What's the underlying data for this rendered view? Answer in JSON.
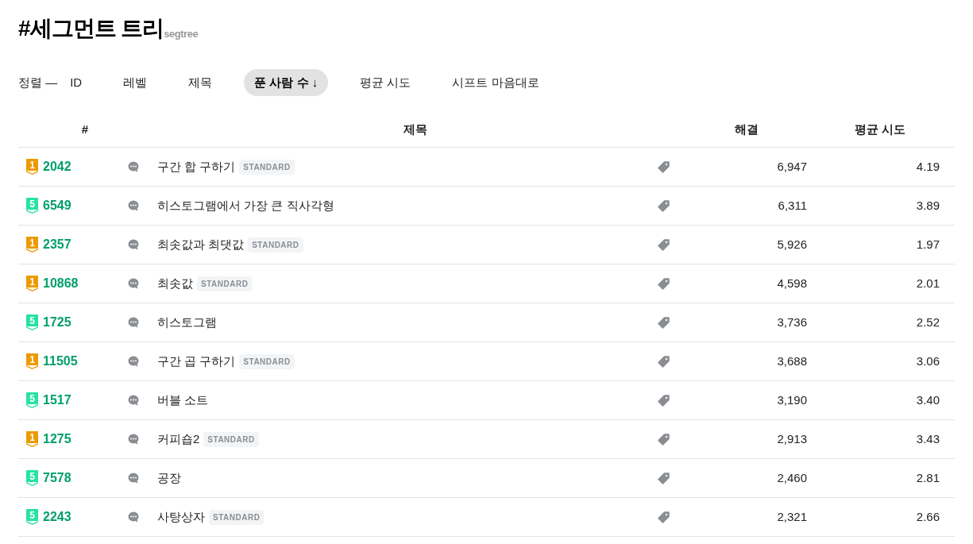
{
  "title": "#세그먼트 트리",
  "subtitle": "segtree",
  "sort": {
    "label": "정렬 —",
    "options": [
      {
        "label": "ID",
        "selected": false
      },
      {
        "label": "레벨",
        "selected": false
      },
      {
        "label": "제목",
        "selected": false
      },
      {
        "label": "푼 사람 수 ↓",
        "selected": true
      },
      {
        "label": "평균 시도",
        "selected": false
      },
      {
        "label": "시프트 마음대로",
        "selected": false
      }
    ]
  },
  "table": {
    "columns": [
      "#",
      "제목",
      "해결",
      "평균 시도"
    ],
    "rows": [
      {
        "color": "#ec9a00",
        "tier_number": "1",
        "id": "2042",
        "title": "구간 합 구하기",
        "tag": "STANDARD",
        "solved": "6,947",
        "average_tries": "4.19"
      },
      {
        "color": "#27e2a4",
        "tier_number": "5",
        "id": "6549",
        "title": "히스토그램에서 가장 큰 직사각형",
        "solved": "6,311",
        "average_tries": "3.89"
      },
      {
        "color": "#ec9a00",
        "tier_number": "1",
        "id": "2357",
        "title": "최솟값과 최댓값",
        "tag": "STANDARD",
        "solved": "5,926",
        "average_tries": "1.97"
      },
      {
        "color": "#ec9a00",
        "tier_number": "1",
        "id": "10868",
        "title": "최솟값",
        "tag": "STANDARD",
        "solved": "4,598",
        "average_tries": "2.01"
      },
      {
        "color": "#27e2a4",
        "tier_number": "5",
        "id": "1725",
        "title": "히스토그램",
        "solved": "3,736",
        "average_tries": "2.52"
      },
      {
        "color": "#ec9a00",
        "tier_number": "1",
        "id": "11505",
        "title": "구간 곱 구하기",
        "tag": "STANDARD",
        "solved": "3,688",
        "average_tries": "3.06"
      },
      {
        "color": "#27e2a4",
        "tier_number": "5",
        "id": "1517",
        "title": "버블 소트",
        "solved": "3,190",
        "average_tries": "3.40"
      },
      {
        "color": "#ec9a00",
        "tier_number": "1",
        "id": "1275",
        "title": "커피숍2",
        "tag": "STANDARD",
        "solved": "2,913",
        "average_tries": "3.43"
      },
      {
        "color": "#27e2a4",
        "tier_number": "5",
        "id": "7578",
        "title": "공장",
        "solved": "2,460",
        "average_tries": "2.81"
      },
      {
        "color": "#27e2a4",
        "tier_number": "5",
        "id": "2243",
        "title": "사탕상자",
        "tag": "STANDARD",
        "solved": "2,321",
        "average_tries": "2.66"
      }
    ]
  }
}
